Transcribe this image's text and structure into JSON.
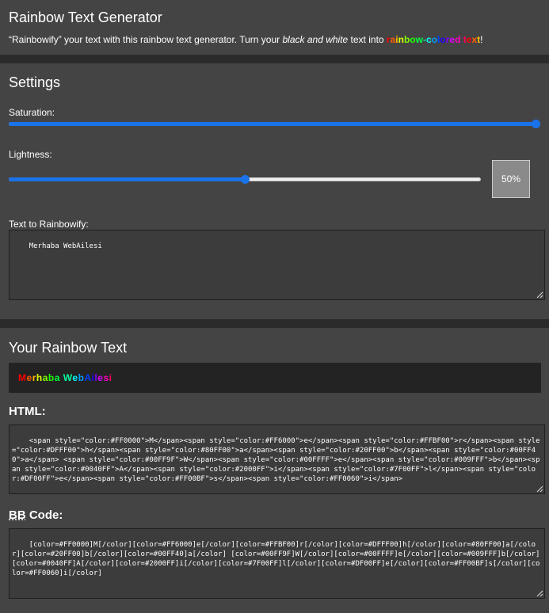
{
  "header": {
    "title": "Rainbow Text Generator",
    "desc_part1": "“Rainbowify” your text with this rainbow text generator. Turn your ",
    "desc_em": "black and white",
    "desc_part2": " text into ",
    "rainbow_word": "rainbow-colored text",
    "desc_end": "!"
  },
  "settings": {
    "title": "Settings",
    "saturation_label": "Saturation:",
    "saturation_percent": 100,
    "lightness_label": "Lightness:",
    "lightness_percent": 50,
    "lightness_value": "50%",
    "text_label": "Text to Rainbowify:",
    "text_value": "Merhaba WebAilesi"
  },
  "output": {
    "title": "Your Rainbow Text",
    "preview_text": "Merhaba WebAilesi",
    "html_label": "HTML:",
    "html_code": "<span style=\"color:#FF0000\">M</span><span style=\"color:#FF6000\">e</span><span style=\"color:#FFBF00\">r</span><span style=\"color:#DFFF00\">h</span><span style=\"color:#80FF00\">a</span><span style=\"color:#20FF00\">b</span><span style=\"color:#00FF40\">a</span> <span style=\"color:#00FF9F\">W</span><span style=\"color:#00FFFF\">e</span><span style=\"color:#009FFF\">b</span><span style=\"color:#0040FF\">A</span><span style=\"color:#2000FF\">i</span><span style=\"color:#7F00FF\">l</span><span style=\"color:#DF00FF\">e</span><span style=\"color:#FF00BF\">s</span><span style=\"color:#FF0060\">i</span>",
    "bb_label_abbr": "BB",
    "bb_label_rest": " Code:",
    "bb_code": "[color=#FF0000]M[/color][color=#FF6000]e[/color][color=#FFBF00]r[/color][color=#DFFF00]h[/color][color=#80FF00]a[/color][color=#20FF00]b[/color][color=#00FF40]a[/color] [color=#00FF9F]W[/color][color=#00FFFF]e[/color][color=#009FFF]b[/color][color=#0040FF]A[/color][color=#2000FF]i[/color][color=#7F00FF]l[/color][color=#DF00FF]e[/color][color=#FF00BF]s[/color][color=#FF0060]i[/color]"
  },
  "colors": {
    "panel": "#444444",
    "background": "#2b2b2b",
    "slider_accent": "#1a73e8",
    "rainbow_palette": [
      "#FF0000",
      "#FF6000",
      "#FFBF00",
      "#DFFF00",
      "#80FF00",
      "#20FF00",
      "#00FF40",
      "#00FF9F",
      "#00FFFF",
      "#009FFF",
      "#0040FF",
      "#2000FF",
      "#7F00FF",
      "#DF00FF",
      "#FF00BF",
      "#FF0060"
    ]
  },
  "icons": {
    "resize": "resize-grip-icon"
  }
}
